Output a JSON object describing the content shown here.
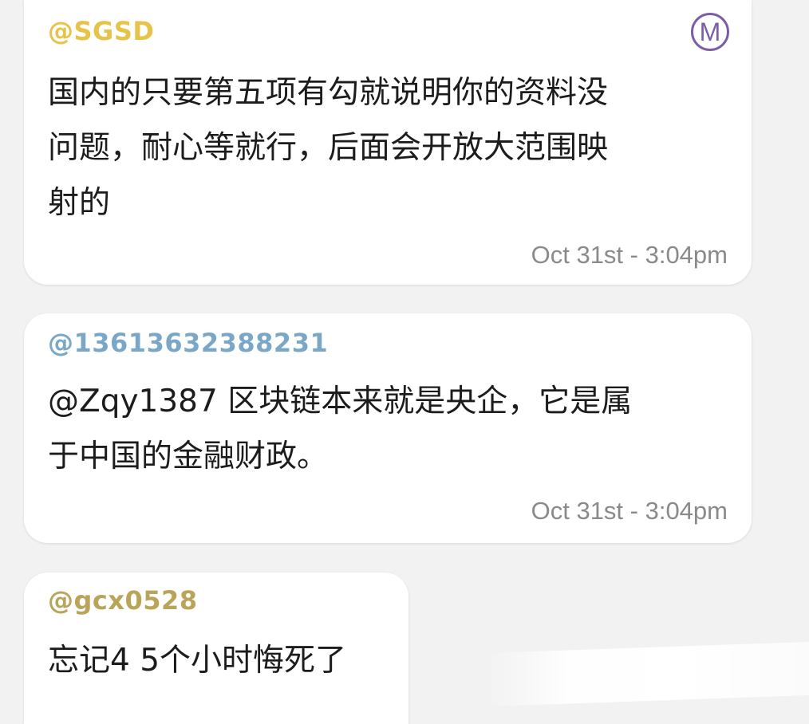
{
  "messages": [
    {
      "sender": "@SGSD",
      "sender_color": "#e6c44a",
      "lines": [
        "国内的只要第五项有勾就说明你的资料没",
        "问题，耐心等就行，后面会开放大范围映",
        "射的"
      ],
      "time": "Oct 31st - 3:04pm",
      "badge": "M",
      "badge_color": "#7b5ea7"
    },
    {
      "sender": "@13613632388231",
      "sender_color": "#7aa7c7",
      "lines": [
        "@Zqy1387 区块链本来就是央企，它是属",
        "于中国的金融财政。"
      ],
      "time": "Oct 31st - 3:04pm"
    },
    {
      "sender": "@gcx0528",
      "sender_color": "#b9a55a",
      "lines": [
        "忘记4 5个小时悔死了"
      ]
    }
  ],
  "colors": {
    "background": "#f2f2f2",
    "bubble": "#ffffff",
    "text": "#1c1c1c",
    "time": "#8a8a8a"
  }
}
